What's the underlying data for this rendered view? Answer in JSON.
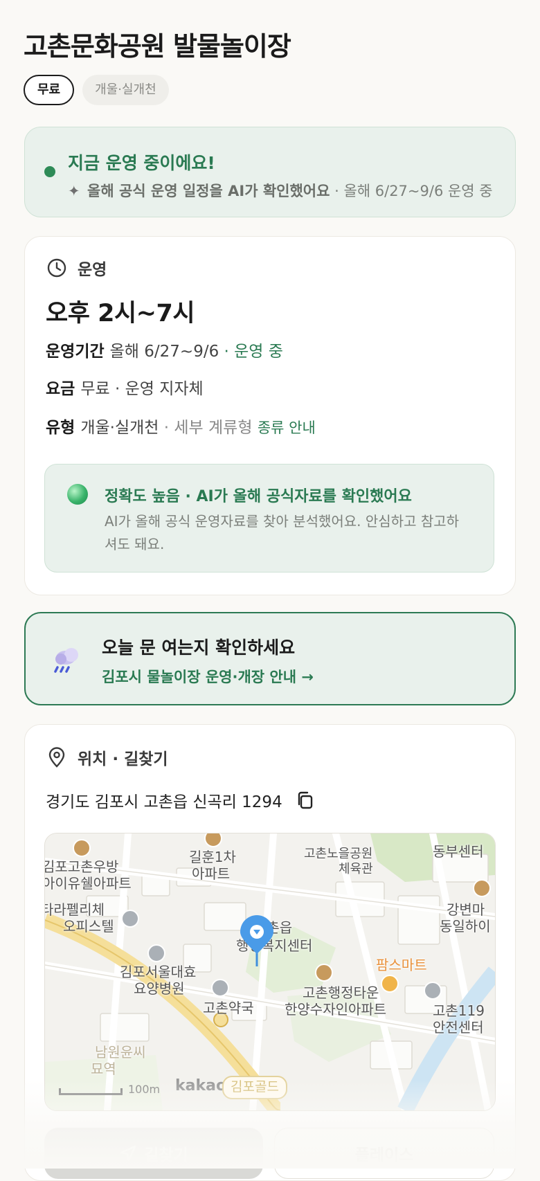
{
  "header": {
    "title": "고촌문화공원 발물놀이장",
    "chips": [
      {
        "label": "무료",
        "selected": true
      },
      {
        "label": "개울·실개천",
        "selected": false
      }
    ]
  },
  "status": {
    "title": "지금 운영 중이에요!",
    "sub_strong": "올해 공식 운영 일정을 AI가 확인했어요",
    "sub_rest": " · 올해 6/27~9/6 운영 중"
  },
  "operation": {
    "section_label": "운영",
    "hours": "오후 2시~7시",
    "period_key": "운영기간",
    "period_value": "올해 6/27~9/6",
    "period_status": " · 운영 중",
    "fee_key": "요금",
    "fee_value": "무료 · 운영 지자체",
    "type_key": "유형",
    "type_value": "개울·실개천",
    "type_detail": " · 세부 계류형 ",
    "type_link": "종류 안내",
    "accuracy": {
      "title": "정확도 높음 · AI가 올해 공식자료를 확인했어요",
      "body": "AI가 올해 공식 운영자료를 찾아 분석했어요. 안심하고 참고하셔도 돼요."
    }
  },
  "notice": {
    "title": "오늘 문 여는지 확인하세요",
    "link": "김포시 물놀이장 운영·개장 안내 →"
  },
  "location": {
    "section_label": "위치 · 길찾기",
    "address": "경기도 김포시 고촌읍 신곡리 1294",
    "map": {
      "labels": [
        "김포고촌우방",
        "아이유쉘아파트",
        "길훈1차",
        "아파트",
        "고촌노을공원",
        "체육관",
        "동부센터",
        "타라펠리체",
        "오피스텔",
        "강변마",
        "동일하이",
        "고촌읍",
        "행정복지센터",
        "팜스마트",
        "김포서울대효",
        "요양병원",
        "고촌약국",
        "고촌행정타운",
        "한양수자인아파트",
        "고촌119",
        "안전센터",
        "남원윤씨",
        "묘역"
      ],
      "scale": "100m",
      "provider": "kakao",
      "station": "김포골드"
    },
    "buttons": {
      "directions": "길찾기",
      "place": "플레이스"
    }
  },
  "colors": {
    "accent_green": "#2a7a52",
    "status_bg": "#e9f1ec",
    "map_pin": "#4a9be8",
    "orange_poi": "#e9913b"
  }
}
